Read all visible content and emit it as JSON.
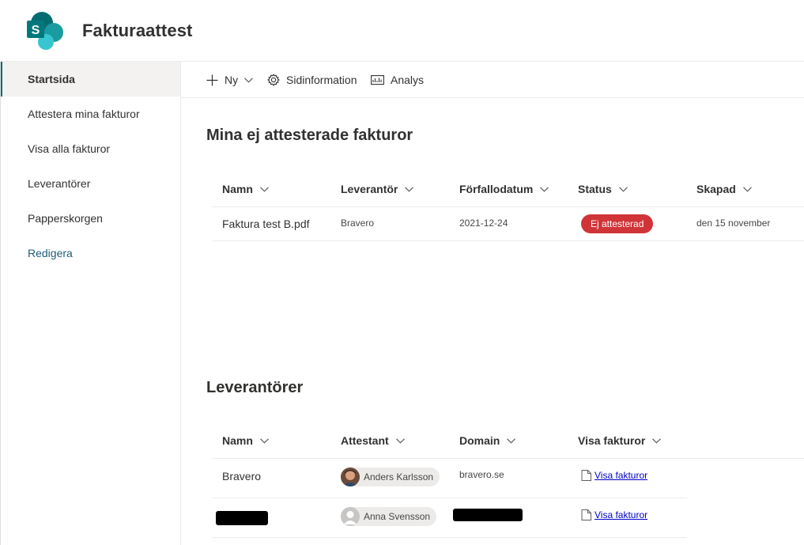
{
  "site": {
    "title": "Fakturaattest",
    "logo_letter": "S"
  },
  "nav": {
    "items": [
      {
        "label": "Startsida",
        "selected": true
      },
      {
        "label": "Attestera mina fakturor"
      },
      {
        "label": "Visa alla fakturor"
      },
      {
        "label": "Leverantörer"
      },
      {
        "label": "Papperskorgen"
      },
      {
        "label": "Redigera"
      }
    ]
  },
  "command_bar": {
    "new_label": "Ny",
    "page_details_label": "Sidinformation",
    "analytics_label": "Analys"
  },
  "invoices": {
    "title": "Mina ej attesterade fakturor",
    "columns": [
      "Namn",
      "Leverantör",
      "Förfallodatum",
      "Status",
      "Skapad"
    ],
    "rows": [
      {
        "name": "Faktura test B.pdf",
        "supplier": "Bravero",
        "due": "2021-12-24",
        "status": "Ej attesterad",
        "created": "den 15 november"
      }
    ]
  },
  "suppliers": {
    "title": "Leverantörer",
    "columns": [
      "Namn",
      "Attestant",
      "Domain",
      "Visa fakturor"
    ],
    "rows": [
      {
        "name": "Bravero",
        "attestant": "Anders Karlsson",
        "domain": "bravero.se",
        "link": "Visa fakturor"
      },
      {
        "name": "",
        "attestant": "Anna Svensson",
        "domain": "",
        "link": "Visa fakturor"
      }
    ]
  },
  "colors": {
    "accent": "#036c70",
    "status_red": "#d13438",
    "link": "#0000cc"
  },
  "icons": [
    "sharepoint-logo-icon",
    "plus-icon",
    "chevron-down-icon",
    "gear-icon",
    "analytics-icon",
    "document-icon",
    "person-icon"
  ]
}
